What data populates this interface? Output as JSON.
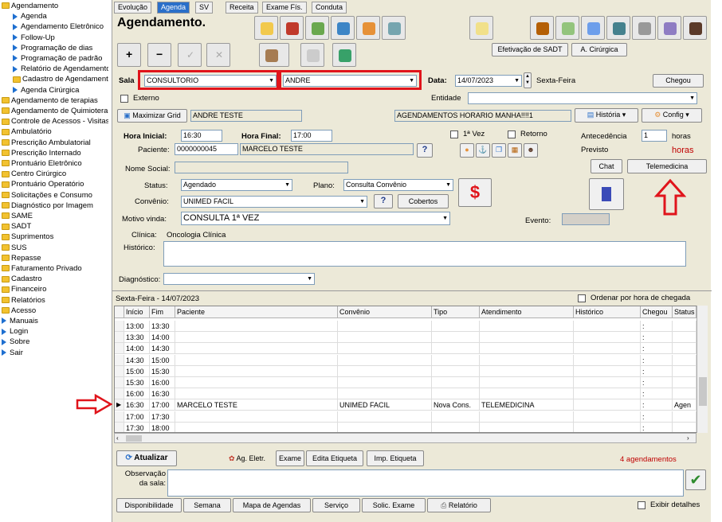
{
  "tree": [
    {
      "label": "Agendamento",
      "kind": "folder",
      "indent": 0
    },
    {
      "label": "Agenda",
      "kind": "item",
      "indent": 1
    },
    {
      "label": "Agendamento Eletrônico",
      "kind": "item",
      "indent": 1
    },
    {
      "label": "Follow-Up",
      "kind": "item",
      "indent": 1
    },
    {
      "label": "Programação de dias",
      "kind": "item",
      "indent": 1
    },
    {
      "label": "Programação de padrão",
      "kind": "item",
      "indent": 1
    },
    {
      "label": "Relatório de Agendamento",
      "kind": "item",
      "indent": 1
    },
    {
      "label": "Cadastro de Agendamento",
      "kind": "folder",
      "indent": 1
    },
    {
      "label": "Agenda Cirúrgica",
      "kind": "item",
      "indent": 1
    },
    {
      "label": "Agendamento de terapias",
      "kind": "folder",
      "indent": 0
    },
    {
      "label": "Agendamento de Quimioterapia",
      "kind": "folder",
      "indent": 0
    },
    {
      "label": "Controle de Acessos - Visitas",
      "kind": "folder",
      "indent": 0
    },
    {
      "label": "Ambulatório",
      "kind": "folder",
      "indent": 0
    },
    {
      "label": "Prescrição Ambulatorial",
      "kind": "folder",
      "indent": 0
    },
    {
      "label": "Prescrição Internado",
      "kind": "folder",
      "indent": 0
    },
    {
      "label": "Prontuário Eletrônico",
      "kind": "folder",
      "indent": 0
    },
    {
      "label": "Centro Cirúrgico",
      "kind": "folder",
      "indent": 0
    },
    {
      "label": "Prontuário Operatório",
      "kind": "folder",
      "indent": 0
    },
    {
      "label": "Solicitações e Consumo",
      "kind": "folder",
      "indent": 0
    },
    {
      "label": "Diagnóstico por Imagem",
      "kind": "folder",
      "indent": 0
    },
    {
      "label": "SAME",
      "kind": "folder",
      "indent": 0
    },
    {
      "label": "SADT",
      "kind": "folder",
      "indent": 0
    },
    {
      "label": "Suprimentos",
      "kind": "folder",
      "indent": 0
    },
    {
      "label": "SUS",
      "kind": "folder",
      "indent": 0
    },
    {
      "label": "Repasse",
      "kind": "folder",
      "indent": 0
    },
    {
      "label": "Faturamento Privado",
      "kind": "folder",
      "indent": 0
    },
    {
      "label": "Cadastro",
      "kind": "folder",
      "indent": 0
    },
    {
      "label": "Financeiro",
      "kind": "folder",
      "indent": 0
    },
    {
      "label": "Relatórios",
      "kind": "folder",
      "indent": 0
    },
    {
      "label": "Acesso",
      "kind": "folder",
      "indent": 0
    },
    {
      "label": "Manuais",
      "kind": "item",
      "indent": 0
    },
    {
      "label": "Login",
      "kind": "item",
      "indent": 0
    },
    {
      "label": "Sobre",
      "kind": "item",
      "indent": 0
    },
    {
      "label": "Sair",
      "kind": "item",
      "indent": 0
    }
  ],
  "tabs": [
    "Evolução",
    "Agenda",
    "SV",
    "Receita",
    "Exame Fís.",
    "Conduta"
  ],
  "title": "Agendamento.",
  "toolbar": {
    "plus": "+",
    "minus": "−",
    "check": "✓",
    "cancel": "✕",
    "efetivacao": "Efetivação de SADT",
    "cirurgica": "A. Cirúrgica"
  },
  "form": {
    "sala_label": "Sala",
    "sala_value": "CONSULTORIO",
    "prof_value": "ANDRE",
    "data_label": "Data:",
    "data_value": "14/07/2023",
    "weekday": "Sexta-Feira",
    "chegou": "Chegou",
    "externo": "Externo",
    "entidade": "Entidade",
    "maximizar": "Maximizar Grid",
    "nome_grid": "ANDRE TESTE",
    "info": "AGENDAMENTOS HORARIO MANHA!!!!1",
    "historia": "História",
    "config": "Config",
    "hora_ini_label": "Hora Inicial:",
    "hora_ini": "16:30",
    "hora_fim_label": "Hora Final:",
    "hora_fim": "17:00",
    "primeira_vez": "1ª Vez",
    "retorno": "Retorno",
    "antecedencia": "Antecedência",
    "antec_value": "1",
    "horas1": "horas",
    "previsto": "Previsto",
    "horas2": "horas",
    "paciente_label": "Paciente:",
    "paciente_id": "0000000045",
    "paciente_nome": "MARCELO TESTE",
    "help": "?",
    "nome_social": "Nome Social:",
    "chat": "Chat",
    "telemedicina": "Telemedicina",
    "status_label": "Status:",
    "status_value": "Agendado",
    "plano_label": "Plano:",
    "plano_value": "Consulta Convênio",
    "dollar": "$",
    "convenio_label": "Convênio:",
    "convenio_value": "UNIMED FACIL",
    "cobertos": "Cobertos",
    "motivo_label": "Motivo vinda:",
    "motivo_value": "CONSULTA 1ª VEZ",
    "evento": "Evento:",
    "clinica_label": "Clínica:",
    "clinica_value": "Oncologia Clínica",
    "historico_label": "Histórico:",
    "diagnostico_label": "Diagnóstico:"
  },
  "grid": {
    "header_date": "Sexta-Feira - 14/07/2023",
    "ordenar": "Ordenar por hora de chegada",
    "columns": [
      "Início",
      "Fim",
      "Paciente",
      "Convênio",
      "Tipo",
      "Atendimento",
      "Histórico",
      "Chegou",
      "Status"
    ],
    "rows": [
      [
        "13:00",
        "13:30",
        "",
        "",
        "",
        "",
        "",
        ":",
        ""
      ],
      [
        "13:30",
        "14:00",
        "",
        "",
        "",
        "",
        "",
        ":",
        ""
      ],
      [
        "14:00",
        "14:30",
        "",
        "",
        "",
        "",
        "",
        ":",
        ""
      ],
      [
        "14:30",
        "15:00",
        "",
        "",
        "",
        "",
        "",
        ":",
        ""
      ],
      [
        "15:00",
        "15:30",
        "",
        "",
        "",
        "",
        "",
        ":",
        ""
      ],
      [
        "15:30",
        "16:00",
        "",
        "",
        "",
        "",
        "",
        ":",
        ""
      ],
      [
        "16:00",
        "16:30",
        "",
        "",
        "",
        "",
        "",
        ":",
        ""
      ],
      [
        "16:30",
        "17:00",
        "MARCELO TESTE",
        "UNIMED FACIL",
        "Nova Cons.",
        "TELEMEDICINA",
        "",
        ":",
        "Agen"
      ],
      [
        "17:00",
        "17:30",
        "",
        "",
        "",
        "",
        "",
        ":",
        ""
      ],
      [
        "17:30",
        "18:00",
        "",
        "",
        "",
        "",
        "",
        ":",
        ""
      ]
    ],
    "selected_row": 7
  },
  "bottom": {
    "atualizar": "Atualizar",
    "ag_eletr": "Ag. Eletr.",
    "exame": "Exame",
    "edita_etiqueta": "Edita Etiqueta",
    "imp_etiqueta": "Imp. Etiqueta",
    "count": "4 agendamentos",
    "obs_label": "Observação da sala:",
    "tabs": [
      "Disponibilidade",
      "Semana",
      "Mapa de Agendas",
      "Serviço",
      "Solic. Exame",
      "Relatório"
    ],
    "exibir": "Exibir detalhes"
  },
  "colors": {
    "highlight_red": "#e0141b",
    "tab_blue": "#2a6fc9",
    "count_red": "#c00000",
    "dollar_red": "#e0141b"
  }
}
